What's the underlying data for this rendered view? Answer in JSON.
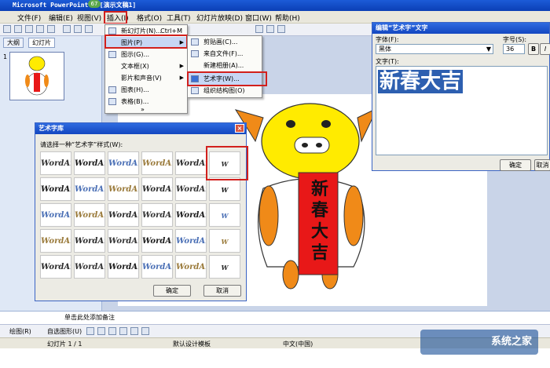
{
  "window": {
    "title": "Microsoft PowerPoint - [演示文稿1]",
    "badge": "67"
  },
  "menubar": {
    "items": [
      "文件(F)",
      "编辑(E)",
      "视图(V)",
      "插入(I)",
      "格式(O)",
      "工具(T)",
      "幻灯片放映(D)",
      "窗口(W)",
      "帮助(H)"
    ]
  },
  "leftpanel": {
    "tabs": [
      "大纲",
      "幻灯片"
    ],
    "slide_number": "1"
  },
  "insert_menu": {
    "items": [
      {
        "label": "新幻灯片(N)...",
        "shortcut": "Ctrl+M"
      },
      {
        "label": "图片(P)"
      },
      {
        "label": "图示(G)..."
      },
      {
        "label": "文本框(X)"
      },
      {
        "label": "影片和声音(V)"
      },
      {
        "label": "图表(H)..."
      },
      {
        "label": "表格(B)..."
      }
    ]
  },
  "picture_menu": {
    "items": [
      "剪贴画(C)...",
      "来自文件(F)...",
      "新建相册(A)...",
      "艺术字(W)...",
      "组织结构图(O)"
    ]
  },
  "wordart_gallery": {
    "title": "艺术字库",
    "prompt": "请选择一种“艺术字”样式(W):",
    "sample": "WordArt",
    "ok": "确定",
    "cancel": "取消",
    "colors": [
      "#333333",
      "#1a1a1a",
      "#4a6fb5",
      "#9a7a3a",
      "#2b2b2b"
    ]
  },
  "edit_wordart": {
    "title": "编辑“艺术字”文字",
    "font_label": "字体(F):",
    "font_value": "黑体",
    "size_label": "字号(S):",
    "size_value": "36",
    "bold_label": "B",
    "italic_label": "I",
    "text_label": "文字(T):",
    "text_value": "新春大吉",
    "ok": "确定",
    "cancel": "取消"
  },
  "slide": {
    "banner_text": [
      "新",
      "春",
      "大",
      "吉"
    ]
  },
  "notes": {
    "placeholder": "单击此处添加备注"
  },
  "drawbar": {
    "draw_label": "绘图(R)",
    "autoshapes_label": "自选图形(U)"
  },
  "status": {
    "slide": "幻灯片 1 / 1",
    "template": "默认设计模板",
    "language": "中文(中国)"
  },
  "watermark": {
    "text": "系统之家"
  }
}
